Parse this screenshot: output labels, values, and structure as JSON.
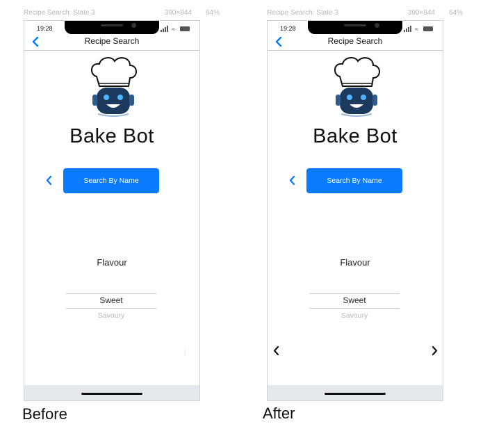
{
  "colors": {
    "accent": "#0a7bff",
    "chef_hat": "#ffffff",
    "robot_body": "#1c3a5e",
    "robot_eye": "#4fb4ff",
    "home_bar_bg": "#e5e7ea"
  },
  "icons": {
    "nav_back": "chevron-left-icon",
    "search_prev": "chevron-left-icon",
    "carousel_prev": "chevron-left-icon",
    "carousel_next": "chevron-right-icon",
    "logo": "chef-robot-logo"
  },
  "panels": [
    {
      "state_name": "Recipe Search: State 3",
      "state_size": "390×844",
      "state_zoom": "64%",
      "time": "19:28",
      "nav_title": "Recipe Search",
      "app_title": "Bake Bot",
      "search_button_label": "Search By Name",
      "flavour_label": "Flavour",
      "picker_selected": "Sweet",
      "picker_next": "Savoury",
      "caption": "Before",
      "show_carousel_arrows": false
    },
    {
      "state_name": "Recipe Search: State 3",
      "state_size": "390×844",
      "state_zoom": "64%",
      "time": "19:28",
      "nav_title": "Recipe Search",
      "app_title": "Bake Bot",
      "search_button_label": "Search By Name",
      "flavour_label": "Flavour",
      "picker_selected": "Sweet",
      "picker_next": "Savoury",
      "caption": "After",
      "show_carousel_arrows": true
    }
  ]
}
